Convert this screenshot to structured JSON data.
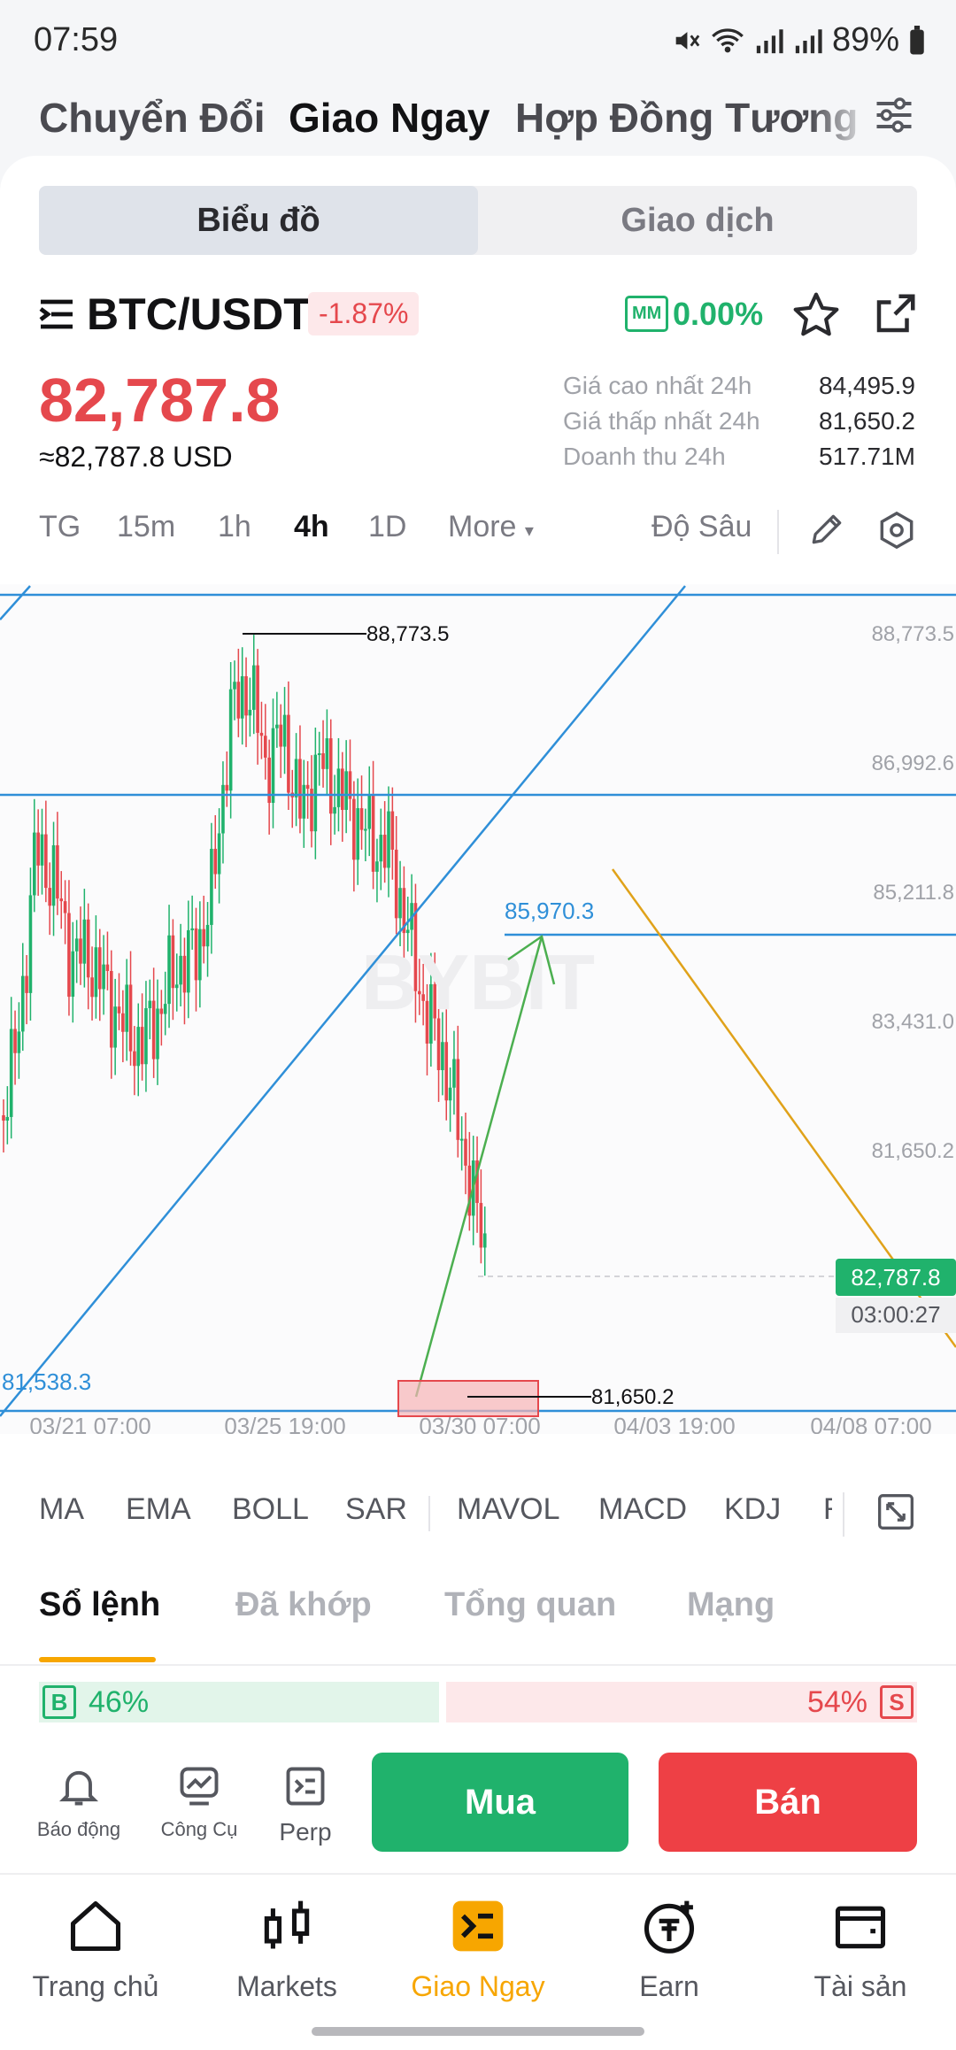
{
  "status_bar": {
    "time": "07:59",
    "battery": "89%"
  },
  "top_tabs": [
    {
      "label": "Chuyển Đổi"
    },
    {
      "label": "Giao Ngay"
    },
    {
      "label": "Hợp Đồng Tương Lai"
    }
  ],
  "segment": {
    "chart_label": "Biểu đồ",
    "trade_label": "Giao dịch"
  },
  "ticker": {
    "pair": "BTC/USDT",
    "change": "-1.87%",
    "mm_badge": "MM",
    "mm_value": "0.00%",
    "price": "82,787.8",
    "price_usd": "≈82,787.8 USD",
    "stats": [
      {
        "label": "Giá cao nhất 24h",
        "value": "84,495.9"
      },
      {
        "label": "Giá thấp nhất 24h",
        "value": "81,650.2"
      },
      {
        "label": "Doanh thu 24h",
        "value": "517.71M"
      }
    ]
  },
  "timeframes": {
    "items": [
      "TG",
      "15m",
      "1h",
      "4h",
      "1D"
    ],
    "active": "4h",
    "more": "More",
    "depth": "Độ Sâu"
  },
  "chart_data": {
    "type": "candlestick",
    "price_ticks": [
      "88,773.5",
      "86,992.6",
      "85,211.8",
      "83,431.0",
      "81,650.2"
    ],
    "time_ticks": [
      "03/21 07:00",
      "03/25 19:00",
      "03/30 07:00",
      "04/03 19:00",
      "04/08 07:00"
    ],
    "annotations": {
      "high_label": "88,773.5",
      "low_label": "81,650.2",
      "target_label": "85,970.3",
      "left_level_label": "81,538.3",
      "current_price": "82,787.8",
      "countdown": "03:00:27"
    },
    "watermark": "BYBIT",
    "colors": {
      "up": "#20b26c",
      "down": "#e5484d",
      "trendline": "#2f8fd8",
      "arrow": "#4caf50",
      "yellow_line": "#e0a21a"
    }
  },
  "indicators": [
    "MA",
    "EMA",
    "BOLL",
    "SAR",
    "MAVOL",
    "MACD",
    "KDJ",
    "R"
  ],
  "orderbook": {
    "tabs": [
      "Sổ lệnh",
      "Đã khớp",
      "Tổng quan",
      "Mạng"
    ],
    "buy_badge": "B",
    "buy_pct": "46%",
    "sell_pct": "54%",
    "sell_badge": "S",
    "buy_ratio": 0.46
  },
  "tools": [
    {
      "label": "Báo động",
      "icon": "bell-icon"
    },
    {
      "label": "Công Cụ",
      "icon": "chart-tool-icon"
    },
    {
      "label": "Perp",
      "icon": "perp-icon"
    }
  ],
  "actions": {
    "buy": "Mua",
    "sell": "Bán"
  },
  "bottom_nav": [
    {
      "label": "Trang chủ",
      "icon": "home-icon"
    },
    {
      "label": "Markets",
      "icon": "markets-icon"
    },
    {
      "label": "Giao Ngay",
      "icon": "spot-icon"
    },
    {
      "label": "Earn",
      "icon": "earn-icon"
    },
    {
      "label": "Tài sản",
      "icon": "wallet-icon"
    }
  ]
}
